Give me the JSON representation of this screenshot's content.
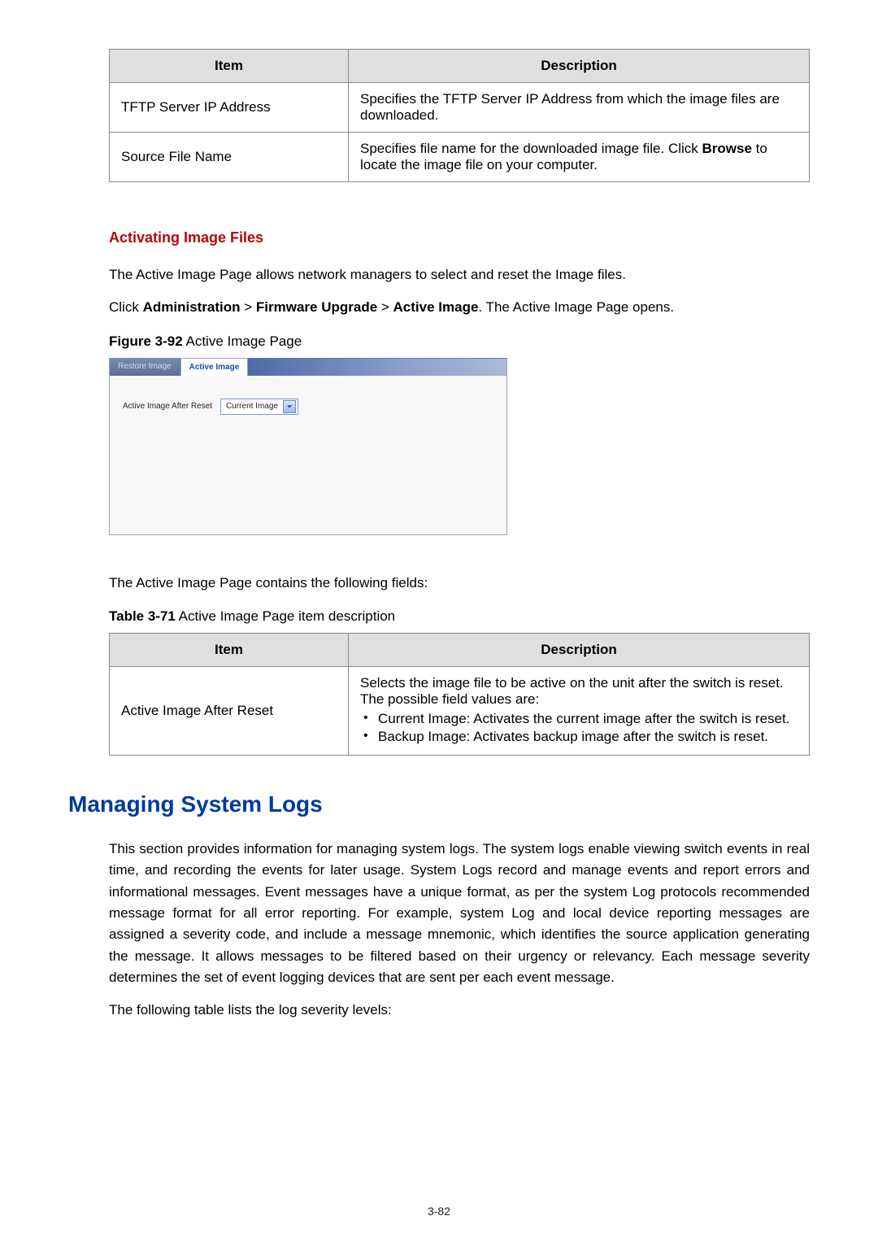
{
  "table1": {
    "headers": {
      "item": "Item",
      "desc": "Description"
    },
    "rows": [
      {
        "item": "TFTP Server IP Address",
        "desc": "Specifies the TFTP Server IP Address from which the image files are downloaded."
      },
      {
        "item": "Source File Name",
        "desc_pre": "Specifies file name for the downloaded image file. Click ",
        "desc_bold": "Browse",
        "desc_post": " to locate the image file on your computer."
      }
    ]
  },
  "sec1": {
    "heading": "Activating Image Files",
    "intro": "The Active Image Page allows network managers to select and reset the Image files.",
    "nav_pre": "Click ",
    "nav_b1": "Administration",
    "nav_b2": "Firmware Upgrade",
    "nav_b3": "Active Image",
    "nav_post": ". The Active Image Page opens.",
    "fig_label": "Figure 3-92",
    "fig_caption": " Active Image Page"
  },
  "screenshot": {
    "tab_inactive": "Restore Image",
    "tab_active": "Active Image",
    "field_label": "Active Image After Reset",
    "select_value": "Current Image"
  },
  "sec2": {
    "intro": "The Active Image Page contains the following fields:",
    "table_label": "Table 3-71",
    "table_caption": " Active Image Page item description",
    "headers": {
      "item": "Item",
      "desc": "Description"
    },
    "row": {
      "item": "Active Image After Reset",
      "lead": "Selects the image file to be active on the unit after the switch is reset. The possible field values are:",
      "bullets": [
        "Current Image: Activates the current image after the switch is reset.",
        "Backup Image: Activates backup image after the switch is reset."
      ]
    }
  },
  "logs": {
    "title": "Managing System Logs",
    "p1": "This section provides information for managing system logs. The system logs enable viewing switch events in real time, and recording the events for later usage. System Logs record and manage events and report errors and informational messages. Event messages have a unique format, as per the system Log protocols recommended message format for all error reporting. For example, system Log and local device reporting messages are assigned a severity code, and include a message mnemonic, which identifies the source application generating the message. It allows messages to be filtered based on their urgency or relevancy. Each message severity determines the set of event logging devices that are sent per each event message.",
    "p2": "The following table lists the log severity levels:"
  },
  "page_number": "3-82"
}
